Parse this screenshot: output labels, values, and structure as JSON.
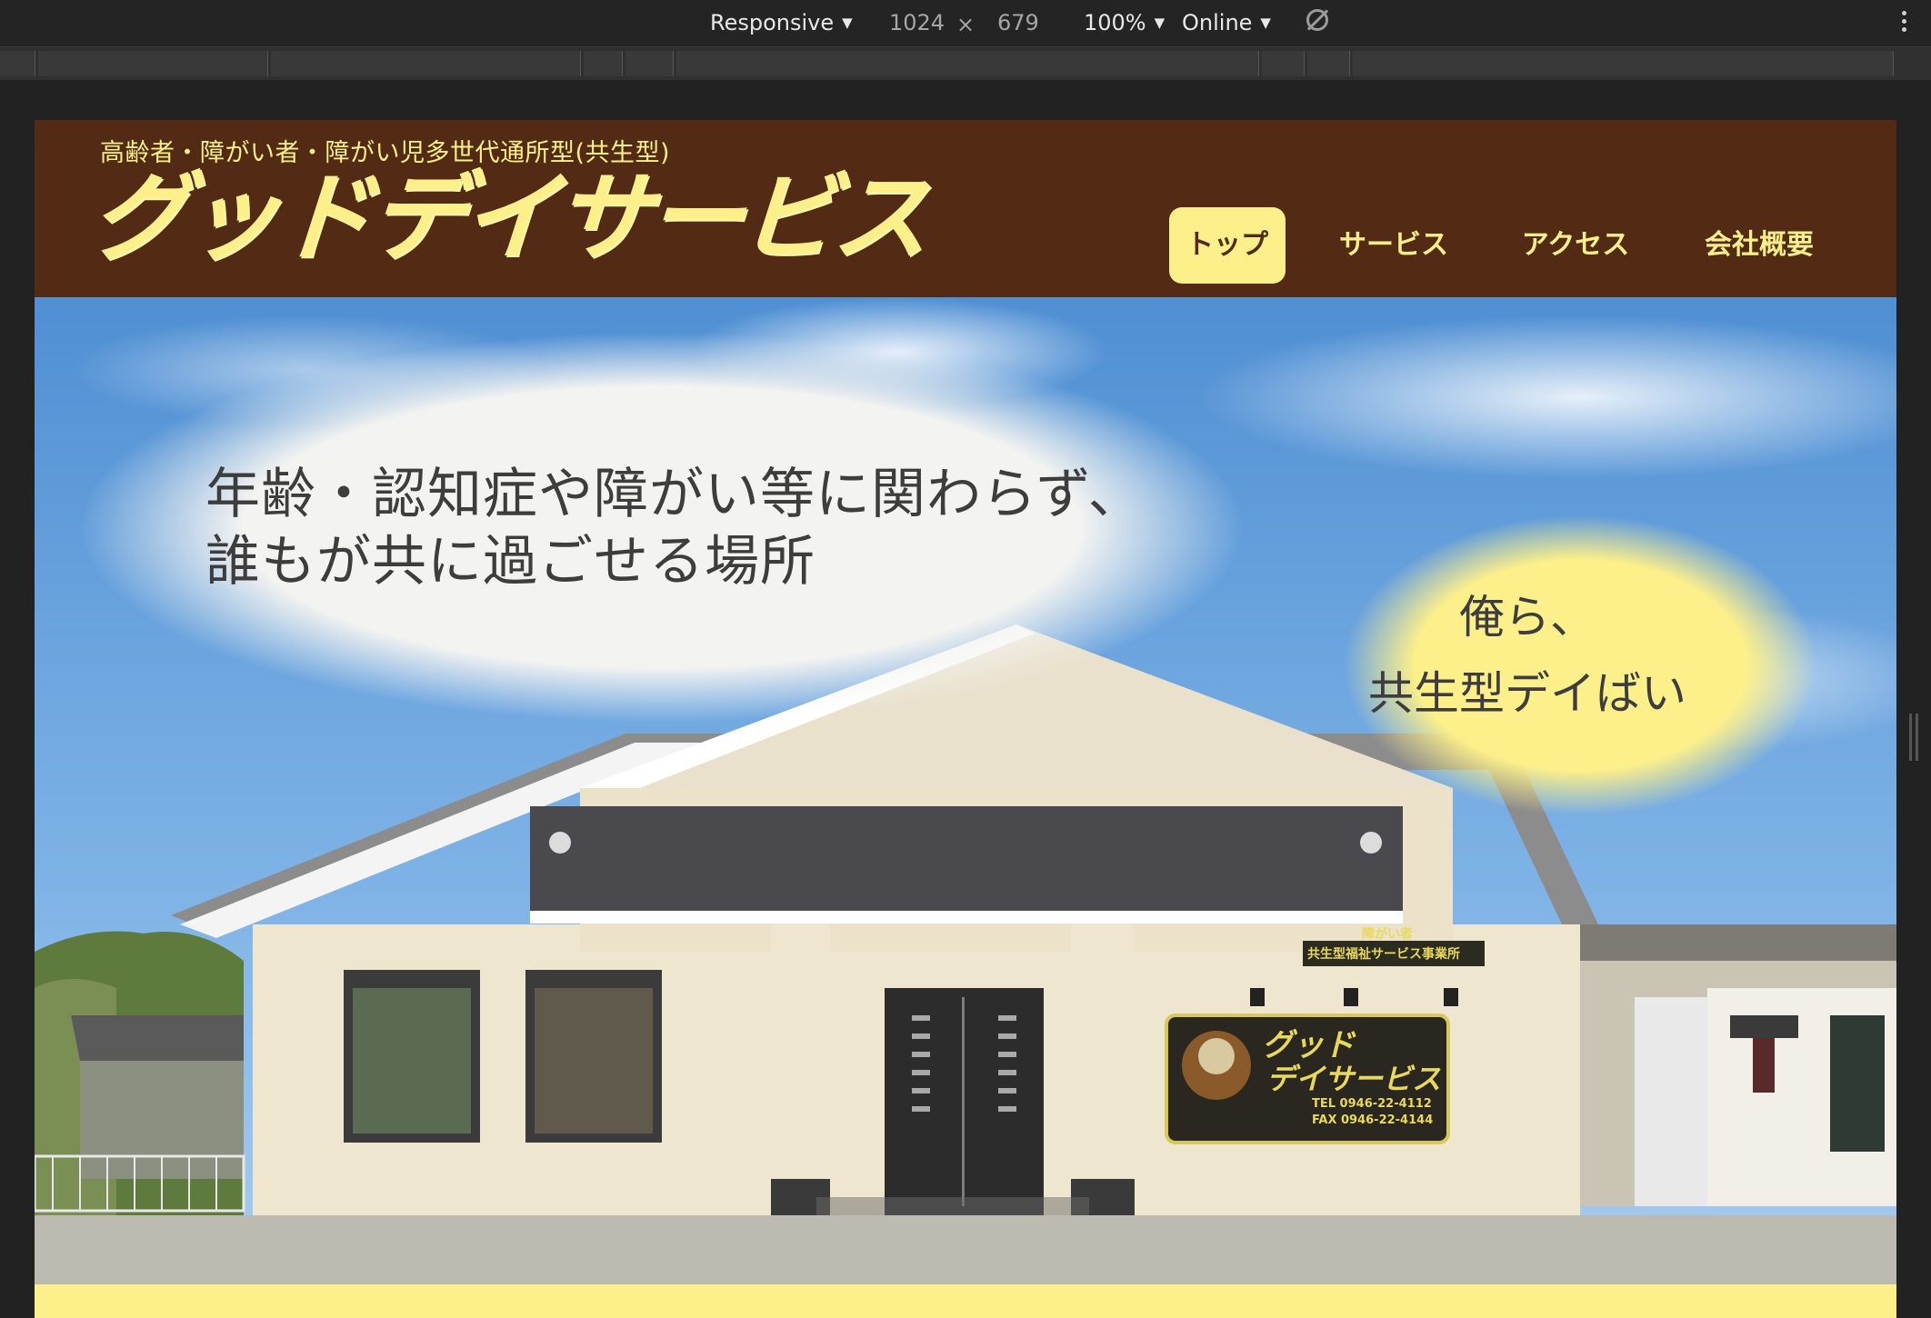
{
  "devtools": {
    "device": "Responsive",
    "width": "1024",
    "times": "×",
    "height": "679",
    "zoom": "100%",
    "network": "Online",
    "caret": "▼"
  },
  "site": {
    "tagline": "高齢者・障がい者・障がい児多世代通所型(共生型)",
    "logo": "グッドデイサービス",
    "nav": [
      {
        "label": "トップ",
        "active": true
      },
      {
        "label": "サービス",
        "active": false
      },
      {
        "label": "アクセス",
        "active": false
      },
      {
        "label": "会社概要",
        "active": false
      }
    ]
  },
  "hero": {
    "bubble_line1": "年齢・認知症や障がい等に関わらず、",
    "bubble_line2": "誰もが共に過ごせる場所",
    "bubble2_line1": "俺ら、",
    "bubble2_line2": "共生型デイばい",
    "building_sign_small": "障がい者",
    "building_sign_name": "共生型福祉サービス事業所",
    "board_title_1": "グッド",
    "board_title_2": "デイサービス",
    "board_tel": "TEL 0946-22-4112",
    "board_fax": "FAX 0946-22-4144",
    "colors": {
      "brown": "#532b15",
      "yellow": "#fdf08a",
      "sky": "#5b9ad6"
    }
  }
}
